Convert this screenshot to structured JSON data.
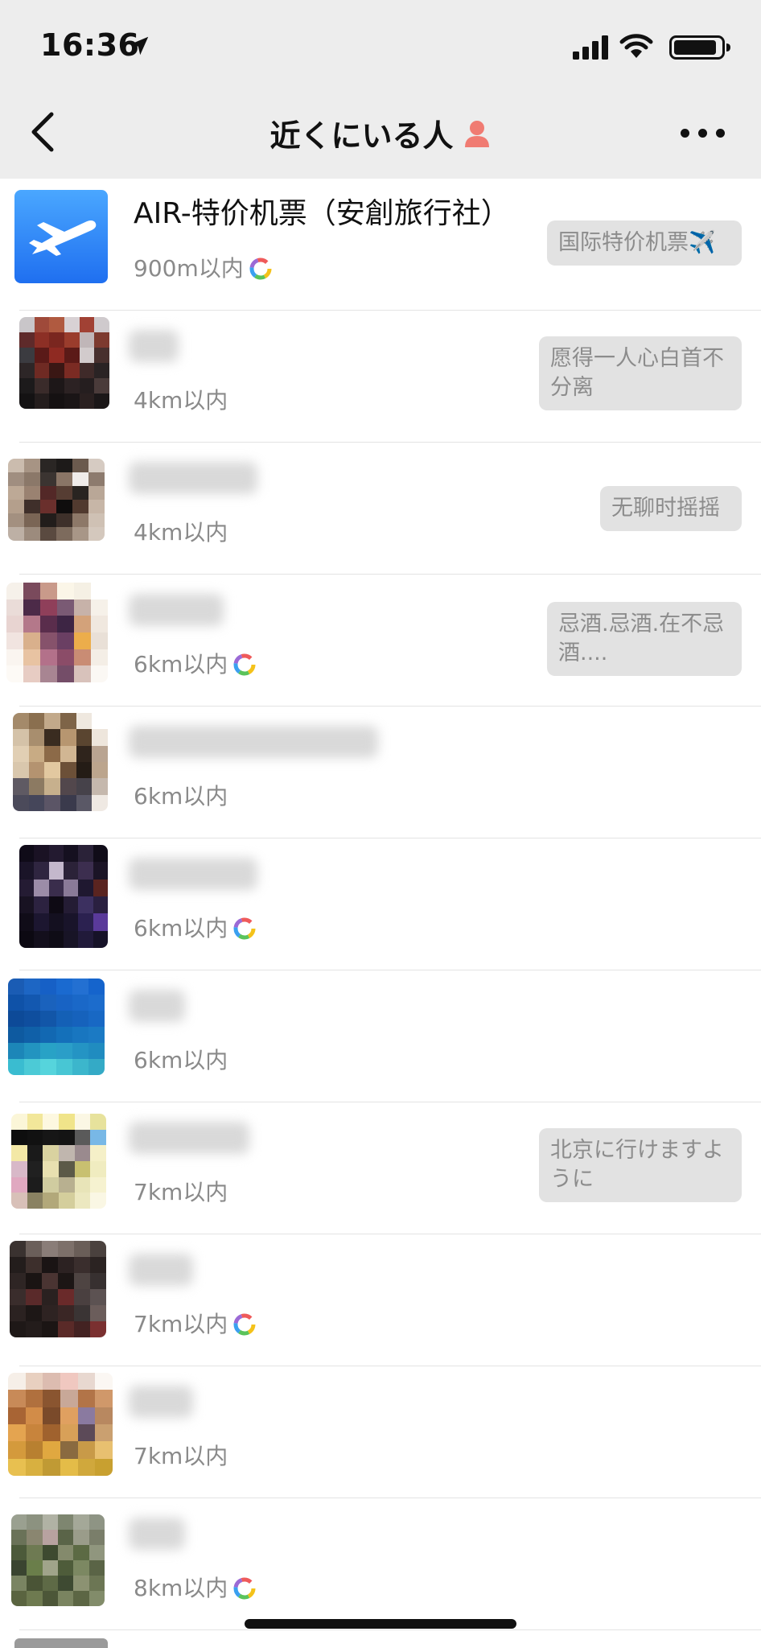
{
  "status_bar": {
    "time": "16:36"
  },
  "nav": {
    "title": "近くにいる人"
  },
  "people": [
    {
      "name": "AIR-特价机票（安創旅行社）",
      "distance": "900m以内",
      "moments": true,
      "signature": "国际特价机票✈️"
    },
    {
      "name": "",
      "distance": "4km以内",
      "moments": false,
      "signature": "愿得一人心白首不分离"
    },
    {
      "name": "",
      "distance": "4km以内",
      "moments": false,
      "signature": "无聊时摇摇"
    },
    {
      "name": "",
      "distance": "6km以内",
      "moments": true,
      "signature": "忌酒.忌酒.在不忌酒...."
    },
    {
      "name": "",
      "distance": "6km以内",
      "moments": false,
      "signature": ""
    },
    {
      "name": "",
      "distance": "6km以内",
      "moments": true,
      "signature": ""
    },
    {
      "name": "",
      "distance": "6km以内",
      "moments": false,
      "signature": ""
    },
    {
      "name": "",
      "distance": "7km以内",
      "moments": false,
      "signature": "北京に行けますように"
    },
    {
      "name": "",
      "distance": "7km以内",
      "moments": true,
      "signature": ""
    },
    {
      "name": "",
      "distance": "7km以内",
      "moments": false,
      "signature": ""
    },
    {
      "name": "",
      "distance": "8km以内",
      "moments": true,
      "signature": ""
    }
  ],
  "icons": {
    "back": "chevron-left-icon",
    "more": "more-dots-icon",
    "title_badge": "person-icon",
    "moments": "moments-ring-icon",
    "location": "location-arrow-icon"
  },
  "colors": {
    "nav_background": "#ededed",
    "bubble_background": "#e2e2e2",
    "distance_text": "#8a8a8a",
    "title_badge": "#f07b72"
  }
}
